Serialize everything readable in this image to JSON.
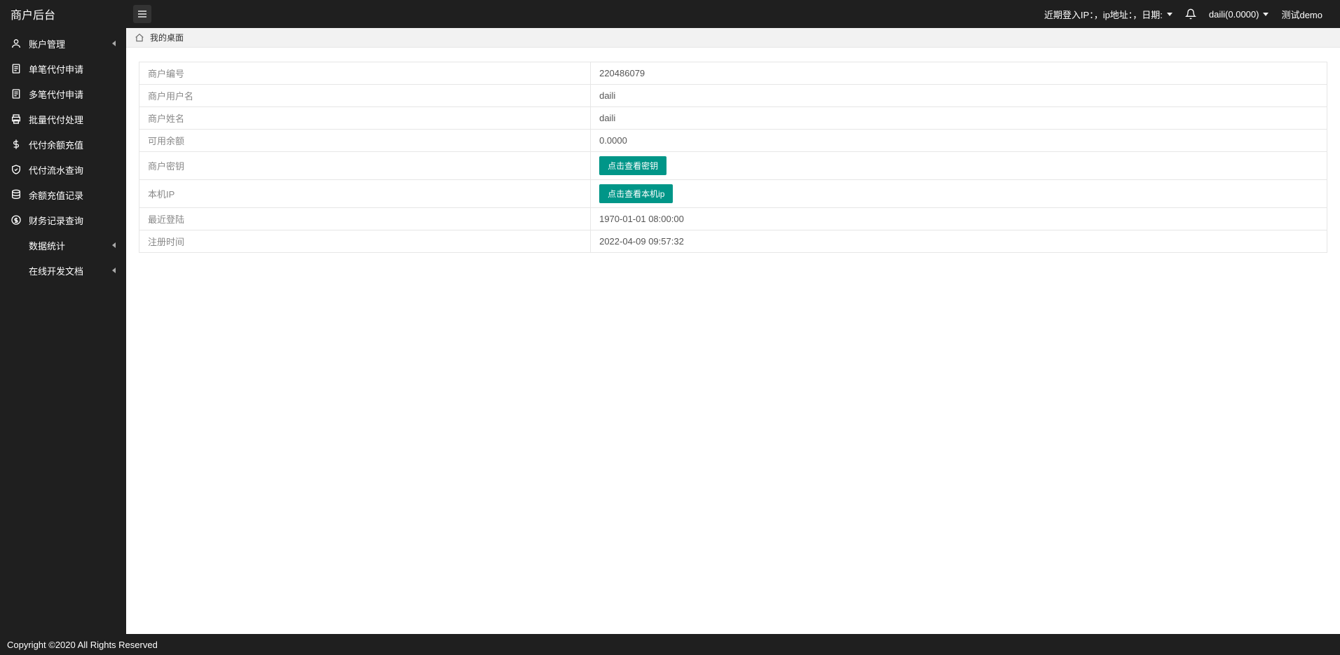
{
  "header": {
    "logo": "商户后台",
    "login_info": "近期登入IP：，ip地址：，日期:",
    "user": "daili(0.0000)",
    "test_demo": "测试demo"
  },
  "sidebar": {
    "items": [
      {
        "label": "账户管理",
        "icon": "user",
        "expandable": true
      },
      {
        "label": "单笔代付申请",
        "icon": "file",
        "expandable": false
      },
      {
        "label": "多笔代付申请",
        "icon": "file",
        "expandable": false
      },
      {
        "label": "批量代付处理",
        "icon": "print",
        "expandable": false
      },
      {
        "label": "代付余额充值",
        "icon": "dollar",
        "expandable": false
      },
      {
        "label": "代付流水查询",
        "icon": "shield",
        "expandable": false
      },
      {
        "label": "余额充值记录",
        "icon": "db",
        "expandable": false
      },
      {
        "label": "财务记录查询",
        "icon": "dollar-circle",
        "expandable": false
      },
      {
        "label": "数据统计",
        "icon": "",
        "expandable": true
      },
      {
        "label": "在线开发文档",
        "icon": "",
        "expandable": true
      }
    ]
  },
  "breadcrumb": {
    "title": "我的桌面"
  },
  "info": {
    "rows": [
      {
        "label": "商户编号",
        "value": "220486079"
      },
      {
        "label": "商户用户名",
        "value": "daili"
      },
      {
        "label": "商户姓名",
        "value": "daili"
      },
      {
        "label": "可用余额",
        "value": "0.0000"
      },
      {
        "label": "商户密钥",
        "button": "点击查看密钥"
      },
      {
        "label": "本机IP",
        "button": "点击查看本机ip"
      },
      {
        "label": "最近登陆",
        "value": "1970-01-01 08:00:00"
      },
      {
        "label": "注册时间",
        "value": "2022-04-09 09:57:32"
      }
    ]
  },
  "footer": {
    "text": "Copyright ©2020 All Rights Reserved"
  }
}
